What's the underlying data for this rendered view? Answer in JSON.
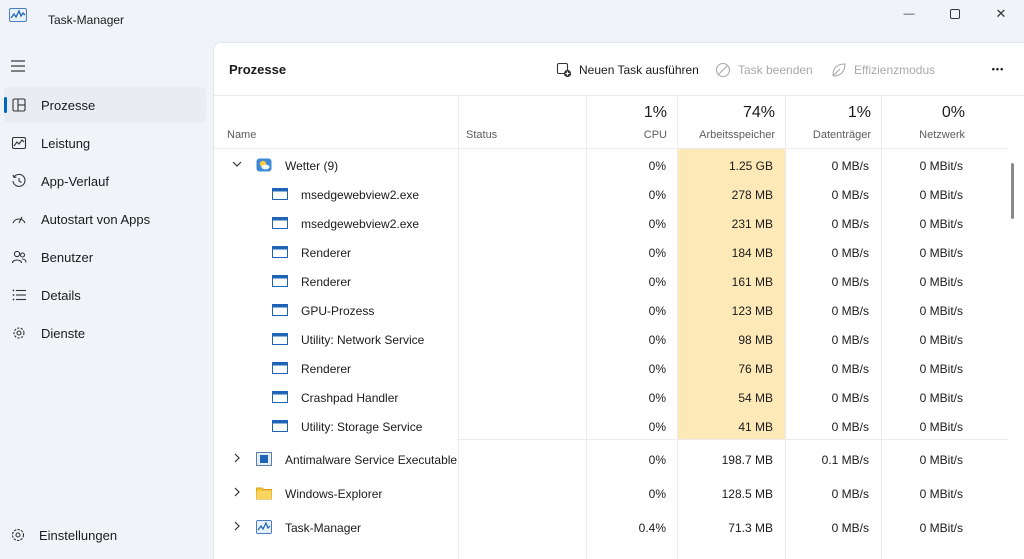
{
  "window": {
    "title": "Task-Manager",
    "minimize_glyph": "—",
    "close_glyph": "✕"
  },
  "sidebar": {
    "items": [
      {
        "label": "Prozesse",
        "icon": "processes-icon",
        "active": true
      },
      {
        "label": "Leistung",
        "icon": "performance-icon"
      },
      {
        "label": "App-Verlauf",
        "icon": "history-icon"
      },
      {
        "label": "Autostart von Apps",
        "icon": "startup-icon"
      },
      {
        "label": "Benutzer",
        "icon": "users-icon"
      },
      {
        "label": "Details",
        "icon": "details-icon"
      },
      {
        "label": "Dienste",
        "icon": "services-icon"
      }
    ],
    "settings_label": "Einstellungen"
  },
  "toolbar": {
    "page_title": "Prozesse",
    "run_task": "Neuen Task ausführen",
    "end_task": "Task beenden",
    "efficiency": "Effizienzmodus",
    "more": "•••"
  },
  "columns": {
    "name": "Name",
    "status": "Status",
    "cpu": {
      "pct": "1%",
      "label": "CPU"
    },
    "memory": {
      "pct": "74%",
      "label": "Arbeitsspeicher"
    },
    "disk": {
      "pct": "1%",
      "label": "Datenträger"
    },
    "network": {
      "pct": "0%",
      "label": "Netzwerk"
    }
  },
  "colors": {
    "accent": "#0067c0",
    "memory_highlight": "#fde9b8",
    "memory_highlight_strong": "#fbd992"
  },
  "processes": [
    {
      "name": "Wetter (9)",
      "icon": "weather-icon",
      "expanded": true,
      "cpu": "0%",
      "mem": "1.25 GB",
      "disk": "0 MB/s",
      "net": "0 MBit/s",
      "children": [
        {
          "name": "msedgewebview2.exe",
          "icon": "window-icon",
          "cpu": "0%",
          "mem": "278 MB",
          "disk": "0 MB/s",
          "net": "0 MBit/s"
        },
        {
          "name": "msedgewebview2.exe",
          "icon": "window-icon",
          "cpu": "0%",
          "mem": "231 MB",
          "disk": "0 MB/s",
          "net": "0 MBit/s"
        },
        {
          "name": "Renderer",
          "icon": "window-icon",
          "cpu": "0%",
          "mem": "184 MB",
          "disk": "0 MB/s",
          "net": "0 MBit/s"
        },
        {
          "name": "Renderer",
          "icon": "window-icon",
          "cpu": "0%",
          "mem": "161 MB",
          "disk": "0 MB/s",
          "net": "0 MBit/s"
        },
        {
          "name": "GPU-Prozess",
          "icon": "window-icon",
          "cpu": "0%",
          "mem": "123 MB",
          "disk": "0 MB/s",
          "net": "0 MBit/s"
        },
        {
          "name": "Utility: Network Service",
          "icon": "window-icon",
          "cpu": "0%",
          "mem": "98 MB",
          "disk": "0 MB/s",
          "net": "0 MBit/s"
        },
        {
          "name": "Renderer",
          "icon": "window-icon",
          "cpu": "0%",
          "mem": "76 MB",
          "disk": "0 MB/s",
          "net": "0 MBit/s"
        },
        {
          "name": "Crashpad Handler",
          "icon": "window-icon",
          "cpu": "0%",
          "mem": "54 MB",
          "disk": "0 MB/s",
          "net": "0 MBit/s"
        },
        {
          "name": "Utility: Storage Service",
          "icon": "window-icon",
          "cpu": "0%",
          "mem": "41 MB",
          "disk": "0 MB/s",
          "net": "0 MBit/s"
        }
      ]
    },
    {
      "name": "Antimalware Service Executable",
      "icon": "defender-icon",
      "expanded": false,
      "cpu": "0%",
      "mem": "198.7 MB",
      "disk": "0.1 MB/s",
      "net": "0 MBit/s"
    },
    {
      "name": "Windows-Explorer",
      "icon": "folder-icon",
      "expanded": false,
      "cpu": "0%",
      "mem": "128.5 MB",
      "disk": "0 MB/s",
      "net": "0 MBit/s"
    },
    {
      "name": "Task-Manager",
      "icon": "taskmanager-icon",
      "expanded": false,
      "cpu": "0.4%",
      "mem": "71.3 MB",
      "disk": "0 MB/s",
      "net": "0 MBit/s"
    }
  ]
}
